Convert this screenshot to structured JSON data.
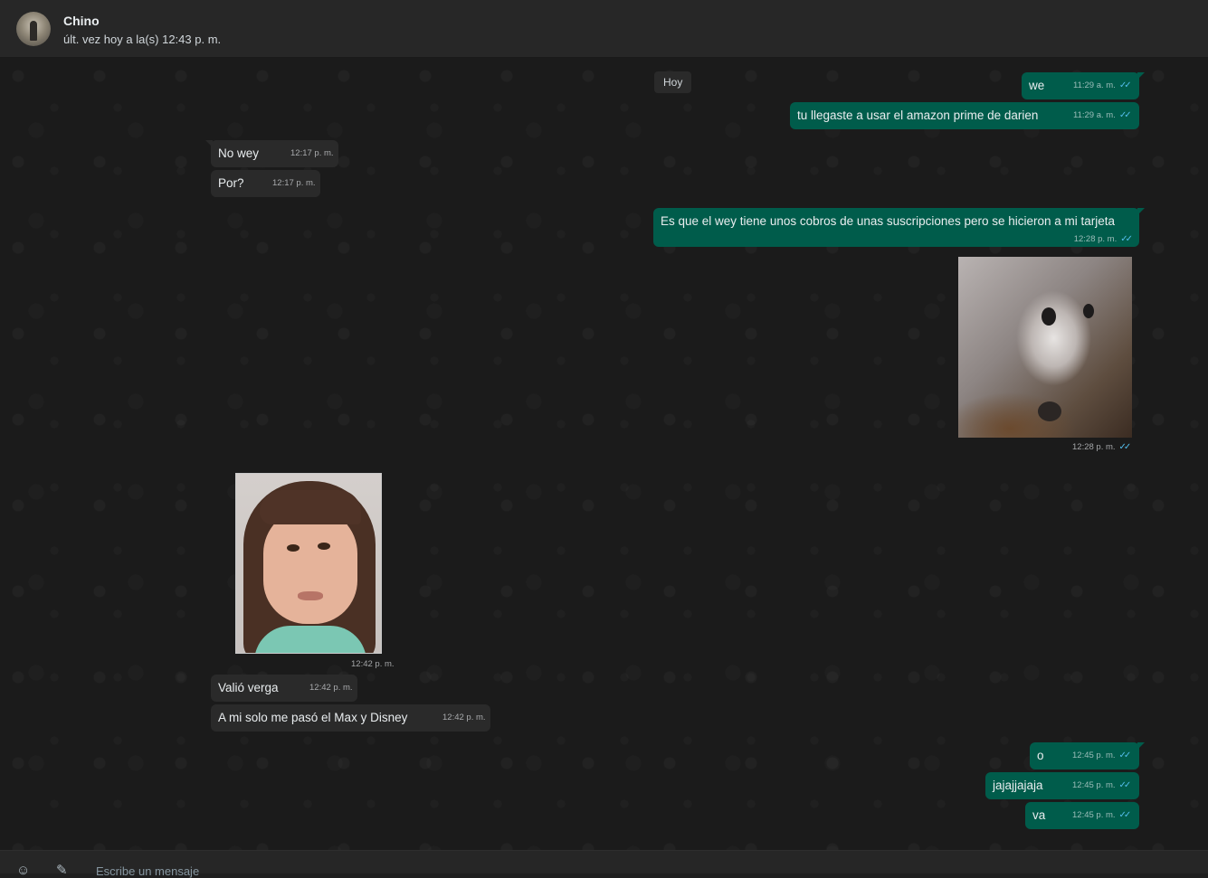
{
  "header": {
    "contact_name": "Chino",
    "status": "últ. vez hoy a la(s) 12:43 p. m."
  },
  "chat": {
    "date_chip": "Hoy",
    "messages": [
      {
        "dir": "out",
        "text": "we",
        "time": "11:29 a. m.",
        "ticks": "✓✓"
      },
      {
        "dir": "out",
        "text": "tu llegaste a usar el amazon prime de darien",
        "time": "11:29 a. m.",
        "ticks": "✓✓"
      },
      {
        "dir": "in",
        "text": "No wey",
        "time": "12:17 p. m."
      },
      {
        "dir": "in",
        "text": "Por?",
        "time": "12:17 p. m."
      },
      {
        "dir": "out",
        "text": "Es que el wey tiene unos cobros de unas suscripciones pero se hicieron a mi tarjeta",
        "time": "12:28 p. m.",
        "ticks": "✓✓"
      },
      {
        "dir": "out",
        "type": "image",
        "time": "12:28 p. m.",
        "ticks": "✓✓"
      },
      {
        "dir": "in",
        "type": "image",
        "time": "12:42 p. m."
      },
      {
        "dir": "in",
        "text": "Valió verga",
        "time": "12:42 p. m."
      },
      {
        "dir": "in",
        "text": "A mi solo me pasó el Max y Disney",
        "time": "12:42 p. m."
      },
      {
        "dir": "out",
        "text": "o",
        "time": "12:45 p. m.",
        "ticks": "✓✓"
      },
      {
        "dir": "out",
        "text": "jajajjajaja",
        "time": "12:45 p. m.",
        "ticks": "✓✓"
      },
      {
        "dir": "out",
        "text": "va",
        "time": "12:45 p. m.",
        "ticks": "✓✓"
      }
    ]
  },
  "composer": {
    "placeholder": "Escribe un mensaje",
    "emoji_icon": "emoji-icon",
    "attach_icon": "paperclip-icon"
  },
  "colors": {
    "outgoing_bubble": "#005c4b",
    "incoming_bubble": "#2a2a2a",
    "read_ticks": "#53bdeb",
    "background": "#1b1b1b"
  }
}
